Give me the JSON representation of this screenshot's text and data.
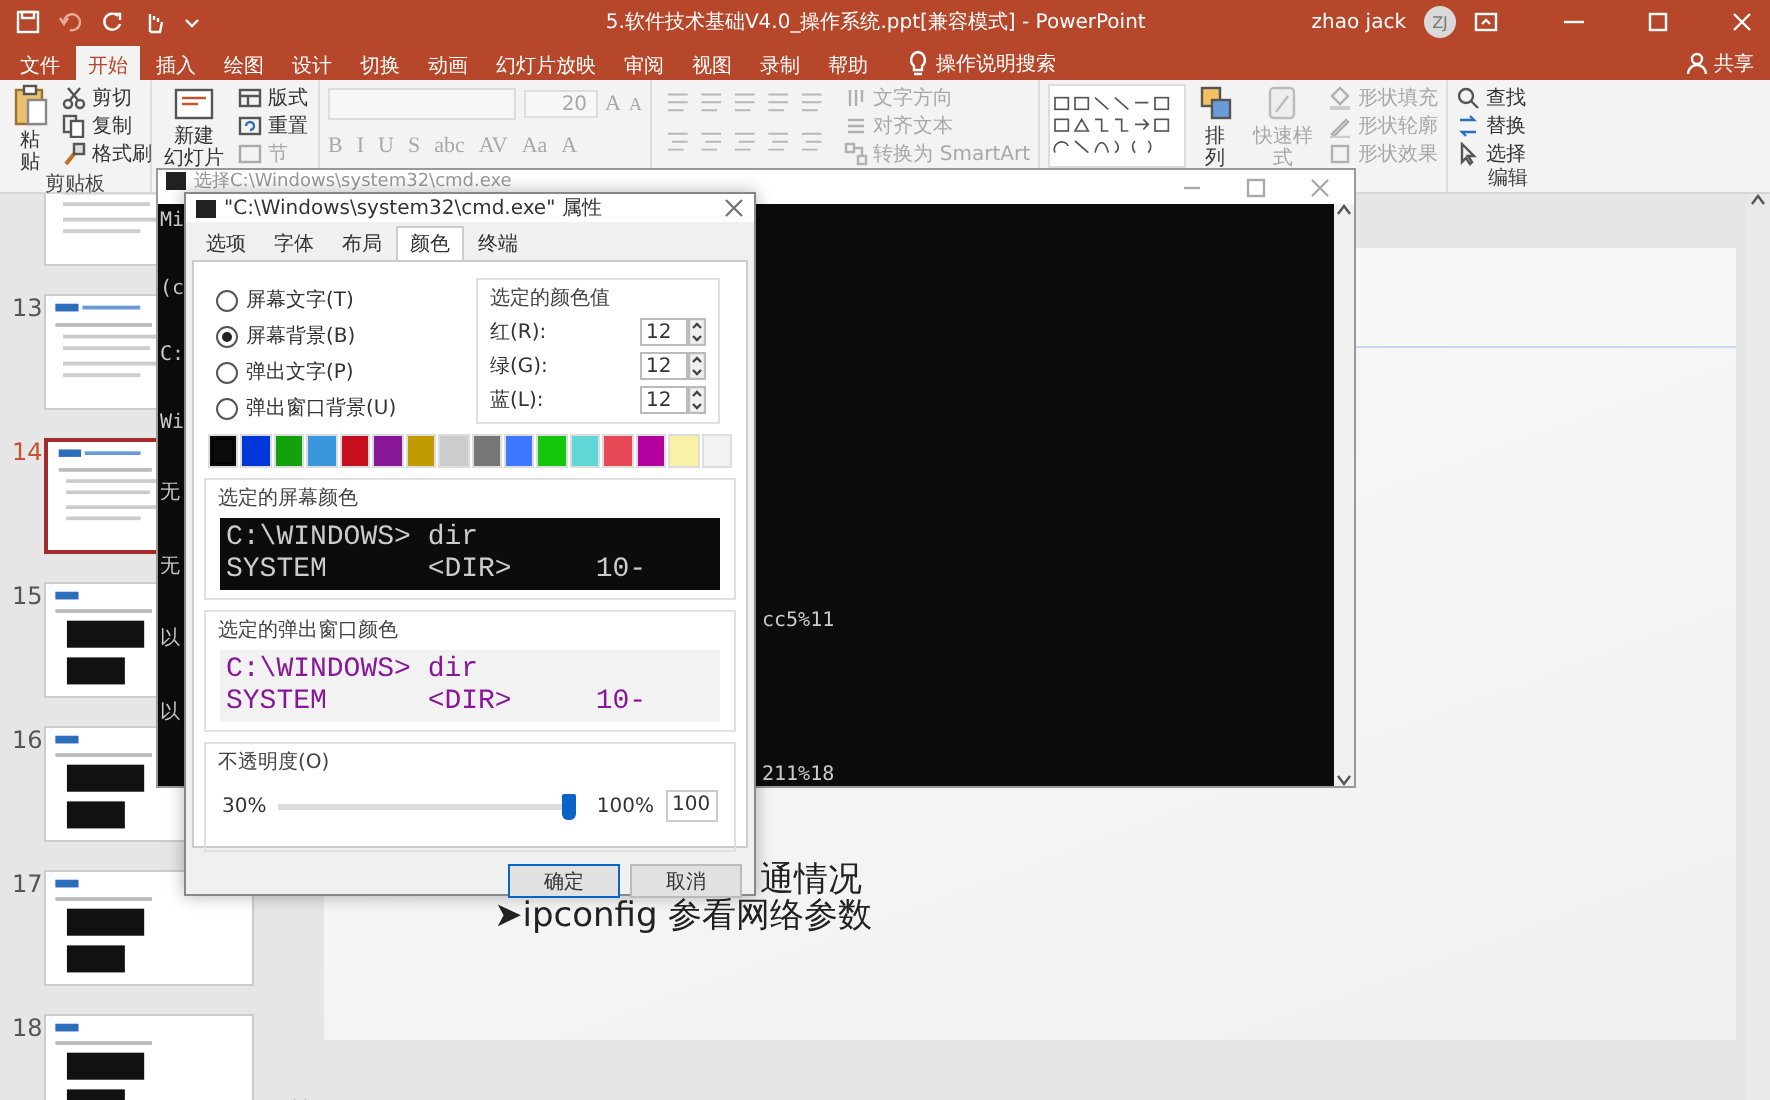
{
  "title_bar": {
    "title": "5.软件技术基础V4.0_操作系统.ppt[兼容模式] - PowerPoint",
    "user": "zhao jack",
    "avatar": "ZJ"
  },
  "menu_tabs": [
    {
      "label": "文件",
      "selected": false
    },
    {
      "label": "开始",
      "selected": true
    },
    {
      "label": "插入",
      "selected": false
    },
    {
      "label": "绘图",
      "selected": false
    },
    {
      "label": "设计",
      "selected": false
    },
    {
      "label": "切换",
      "selected": false
    },
    {
      "label": "动画",
      "selected": false
    },
    {
      "label": "幻灯片放映",
      "selected": false
    },
    {
      "label": "审阅",
      "selected": false
    },
    {
      "label": "视图",
      "selected": false
    },
    {
      "label": "录制",
      "selected": false
    },
    {
      "label": "帮助",
      "selected": false
    }
  ],
  "search_hint": "操作说明搜索",
  "share": "共享",
  "ribbon": {
    "clipboard": {
      "paste": "粘贴",
      "items": [
        "剪切",
        "复制",
        "格式刷"
      ],
      "label": "剪贴板"
    },
    "slides": {
      "new_slide": [
        "新建",
        "幻灯片"
      ],
      "items": [
        "版式",
        "重置",
        "节"
      ]
    },
    "font": {
      "disabled": true,
      "size": "20",
      "size_buttons": [
        "A",
        "A"
      ],
      "styles": [
        "B",
        "I",
        "U",
        "S",
        "abc",
        "AV",
        "Aa",
        "A"
      ]
    },
    "paragraph": {
      "disabled": true,
      "items": [
        "文字方向",
        "对齐文本",
        "转换为 SmartArt"
      ]
    },
    "drawing": {
      "arrange": "排列",
      "quick_styles": {
        "label": "快速样式",
        "disabled": true
      },
      "items": [
        {
          "label": "形状填充",
          "disabled": true
        },
        {
          "label": "形状轮廓",
          "disabled": true
        },
        {
          "label": "形状效果",
          "disabled": true
        }
      ]
    },
    "editing": {
      "items": [
        "查找",
        "替换",
        "选择"
      ],
      "label": "编辑"
    }
  },
  "thumbnails": [
    {
      "kind": "text",
      "selected": false
    },
    {
      "number": "13",
      "kind": "text",
      "selected": false
    },
    {
      "number": "14",
      "kind": "text",
      "selected": true
    },
    {
      "number": "15",
      "kind": "console",
      "selected": false
    },
    {
      "number": "16",
      "kind": "console",
      "selected": false
    },
    {
      "number": "17",
      "kind": "console",
      "selected": false
    },
    {
      "number": "18",
      "kind": "console",
      "selected": false
    }
  ],
  "slide": {
    "lines": [
      "通情况",
      "➤ipconfig 参看网络参数"
    ]
  },
  "cmd_window": {
    "title": "选择C:\\Windows\\system32\\cmd.exe",
    "left_fragments": [
      "Mi",
      "(c",
      "C:",
      "Wi",
      "无",
      "无",
      "以",
      "以"
    ],
    "right_fragments": [
      "cc5%11",
      "211%18"
    ]
  },
  "dialog": {
    "title": "\"C:\\Windows\\system32\\cmd.exe\" 属性",
    "tabs": [
      {
        "label": "选项",
        "selected": false
      },
      {
        "label": "字体",
        "selected": false
      },
      {
        "label": "布局",
        "selected": false
      },
      {
        "label": "颜色",
        "selected": true
      },
      {
        "label": "终端",
        "selected": false
      }
    ],
    "radios": [
      {
        "label": "屏幕文字(T)",
        "selected": false
      },
      {
        "label": "屏幕背景(B)",
        "selected": true
      },
      {
        "label": "弹出文字(P)",
        "selected": false
      },
      {
        "label": "弹出窗口背景(U)",
        "selected": false
      }
    ],
    "color_values": {
      "title": "选定的颜色值",
      "fields": [
        {
          "label": "红(R):",
          "value": "12"
        },
        {
          "label": "绿(G):",
          "value": "12"
        },
        {
          "label": "蓝(L):",
          "value": "12"
        }
      ]
    },
    "palette": [
      {
        "color": "#0c0c0c",
        "selected": true
      },
      {
        "color": "#0037da",
        "selected": false
      },
      {
        "color": "#13a10e",
        "selected": false
      },
      {
        "color": "#3a96dd",
        "selected": false
      },
      {
        "color": "#c50f1f",
        "selected": false
      },
      {
        "color": "#881798",
        "selected": false
      },
      {
        "color": "#c19c00",
        "selected": false
      },
      {
        "color": "#cccccc",
        "selected": false
      },
      {
        "color": "#767676",
        "selected": false
      },
      {
        "color": "#3b78ff",
        "selected": false
      },
      {
        "color": "#16c60c",
        "selected": false
      },
      {
        "color": "#61d6d6",
        "selected": false
      },
      {
        "color": "#e74856",
        "selected": false
      },
      {
        "color": "#b4009e",
        "selected": false
      },
      {
        "color": "#f9f1a5",
        "selected": false
      },
      {
        "color": "#f2f2f2",
        "selected": false
      }
    ],
    "screen_preview": {
      "title": "选定的屏幕颜色",
      "lines": [
        "C:\\WINDOWS> dir",
        "SYSTEM      <DIR>     10-"
      ]
    },
    "popup_preview": {
      "title": "选定的弹出窗口颜色",
      "lines": [
        "C:\\WINDOWS> dir",
        "SYSTEM      <DIR>     10-"
      ]
    },
    "opacity": {
      "title": "不透明度(O)",
      "min": "30%",
      "max": "100%",
      "level": 1,
      "value": "100"
    },
    "buttons": [
      {
        "label": "确定",
        "default": true
      },
      {
        "label": "取消",
        "default": false
      }
    ]
  }
}
